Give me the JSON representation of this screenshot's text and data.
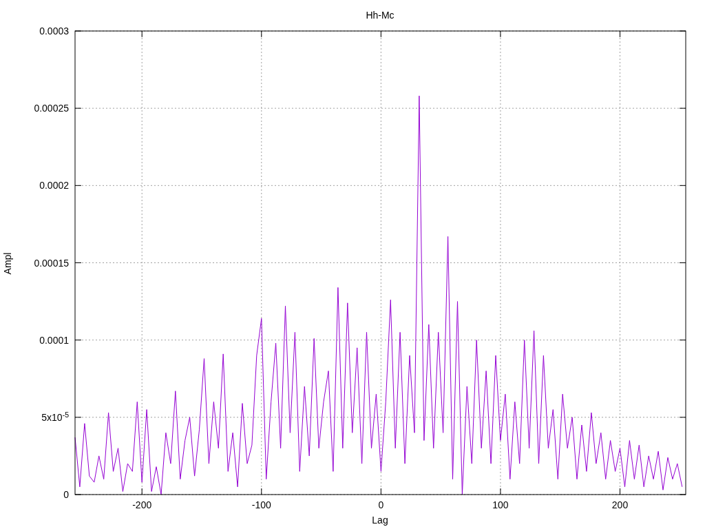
{
  "chart_data": {
    "type": "line",
    "title": "Hh-Mc",
    "xlabel": "Lag",
    "ylabel": "Ampl",
    "xlim": [
      -256,
      255
    ],
    "ylim": [
      0,
      0.0003
    ],
    "xticks": [
      -200,
      -100,
      0,
      100,
      200
    ],
    "yticks": [
      {
        "value": 0,
        "label": "0"
      },
      {
        "value": 5e-05,
        "label": "5x10$^{-5}$"
      },
      {
        "value": 0.0001,
        "label": "0.0001"
      },
      {
        "value": 0.00015,
        "label": "0.00015"
      },
      {
        "value": 0.0002,
        "label": "0.0002"
      },
      {
        "value": 0.00025,
        "label": "0.00025"
      },
      {
        "value": 0.0003,
        "label": "0.0003"
      }
    ],
    "x": [
      -256,
      -252,
      -248,
      -244,
      -240,
      -236,
      -232,
      -228,
      -224,
      -220,
      -216,
      -212,
      -208,
      -204,
      -200,
      -196,
      -192,
      -188,
      -184,
      -180,
      -176,
      -172,
      -168,
      -164,
      -160,
      -156,
      -152,
      -148,
      -144,
      -140,
      -136,
      -132,
      -128,
      -124,
      -120,
      -116,
      -112,
      -108,
      -104,
      -100,
      -96,
      -92,
      -88,
      -84,
      -80,
      -76,
      -72,
      -68,
      -64,
      -60,
      -56,
      -52,
      -48,
      -44,
      -40,
      -36,
      -32,
      -28,
      -24,
      -20,
      -16,
      -12,
      -8,
      -4,
      0,
      4,
      8,
      12,
      16,
      20,
      24,
      28,
      32,
      36,
      40,
      44,
      48,
      52,
      56,
      60,
      64,
      68,
      72,
      76,
      80,
      84,
      88,
      92,
      96,
      100,
      104,
      108,
      112,
      116,
      120,
      124,
      128,
      132,
      136,
      140,
      144,
      148,
      152,
      156,
      160,
      164,
      168,
      172,
      176,
      180,
      184,
      188,
      192,
      196,
      200,
      204,
      208,
      212,
      216,
      220,
      224,
      228,
      232,
      236,
      240,
      244,
      248,
      252
    ],
    "grid": true,
    "series": [
      {
        "color": "#9400d3",
        "values": [
          3.7e-05,
          5e-06,
          4.6e-05,
          1.2e-05,
          8e-06,
          2.5e-05,
          1e-05,
          5.3e-05,
          1.5e-05,
          3e-05,
          2e-06,
          2e-05,
          1.5e-05,
          6e-05,
          8e-06,
          5.5e-05,
          2e-06,
          1.8e-05,
          0,
          4e-05,
          2e-05,
          6.7e-05,
          1e-05,
          3.5e-05,
          5e-05,
          1.2e-05,
          4.2e-05,
          8.8e-05,
          2e-05,
          6e-05,
          3e-05,
          9.1e-05,
          1.5e-05,
          4e-05,
          5e-06,
          5.9e-05,
          2e-05,
          3.2e-05,
          9e-05,
          0.000114,
          1e-05,
          6e-05,
          9.8e-05,
          3e-05,
          0.000122,
          4e-05,
          0.000105,
          1.5e-05,
          7e-05,
          2.5e-05,
          0.000101,
          3e-05,
          6e-05,
          8e-05,
          1.5e-05,
          0.000134,
          3e-05,
          0.000124,
          4e-05,
          9.5e-05,
          2e-05,
          0.000105,
          3e-05,
          6.5e-05,
          1.5e-05,
          6e-05,
          0.000126,
          3e-05,
          0.000105,
          2e-05,
          9e-05,
          4e-05,
          0.000258,
          3.5e-05,
          0.00011,
          3e-05,
          0.000105,
          4e-05,
          0.000167,
          1e-05,
          0.000125,
          0,
          7e-05,
          2e-05,
          0.0001,
          3e-05,
          8e-05,
          2e-05,
          9e-05,
          3.5e-05,
          6.5e-05,
          1e-05,
          6e-05,
          2e-05,
          0.0001,
          3e-05,
          0.000106,
          2e-05,
          9e-05,
          3e-05,
          5.5e-05,
          1e-05,
          6.5e-05,
          3e-05,
          5e-05,
          1e-05,
          4.5e-05,
          1.5e-05,
          5.3e-05,
          2e-05,
          4e-05,
          1e-05,
          3.5e-05,
          1.5e-05,
          3e-05,
          5e-06,
          3.5e-05,
          1e-05,
          3.2e-05,
          5e-06,
          2.5e-05,
          1e-05,
          2.8e-05,
          3e-06,
          2.4e-05,
          1e-05,
          2e-05,
          5e-06
        ]
      }
    ]
  }
}
